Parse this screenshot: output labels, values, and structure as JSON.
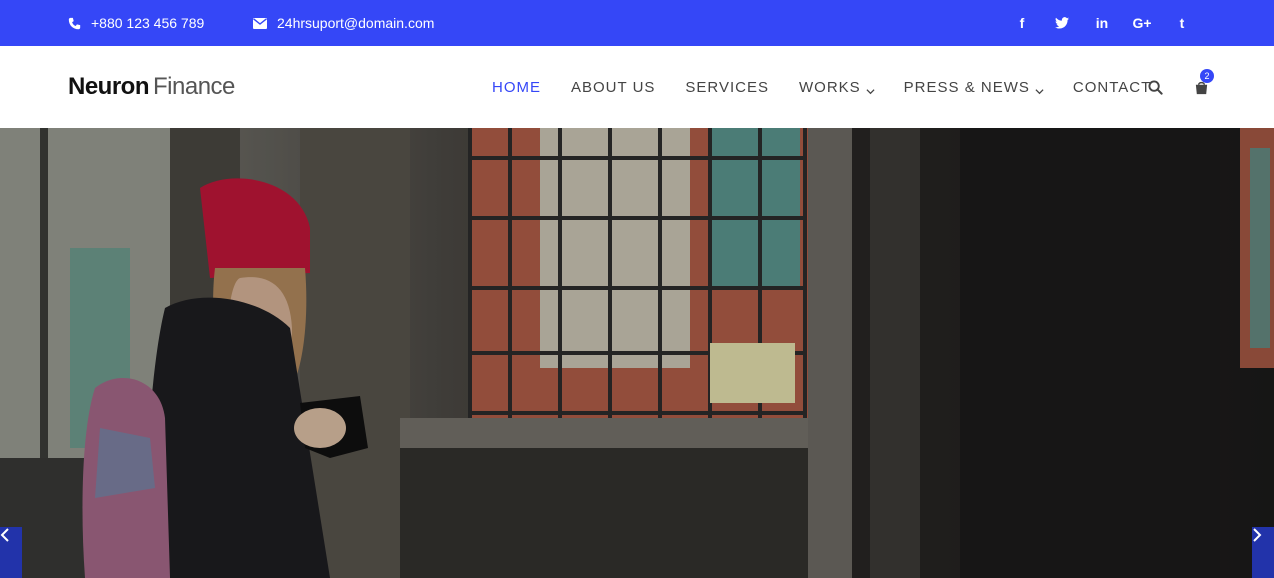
{
  "topbar": {
    "phone": "+880 123 456 789",
    "email": "24hrsuport@domain.com",
    "social": [
      {
        "icon": "facebook-icon",
        "glyph": "f"
      },
      {
        "icon": "twitter-icon",
        "glyph": "t"
      },
      {
        "icon": "linkedin-icon",
        "glyph": "in"
      },
      {
        "icon": "google-plus-icon",
        "glyph": "G+"
      },
      {
        "icon": "tumblr-icon",
        "glyph": "t"
      }
    ],
    "color": "#3547f7"
  },
  "header": {
    "logo_bold": "Neuron",
    "logo_light": "Finance",
    "nav": [
      {
        "label": "HOME",
        "active": true,
        "dropdown": false
      },
      {
        "label": "ABOUT US",
        "active": false,
        "dropdown": false
      },
      {
        "label": "SERVICES",
        "active": false,
        "dropdown": false
      },
      {
        "label": "WORKS",
        "active": false,
        "dropdown": true
      },
      {
        "label": "PRESS & NEWS",
        "active": false,
        "dropdown": true
      },
      {
        "label": "CONTACT",
        "active": false,
        "dropdown": false
      }
    ],
    "cart_count": "2",
    "accent": "#3547f7"
  },
  "hero": {
    "slider_prev_icon": "chevron-left-icon",
    "slider_next_icon": "chevron-right-icon"
  }
}
